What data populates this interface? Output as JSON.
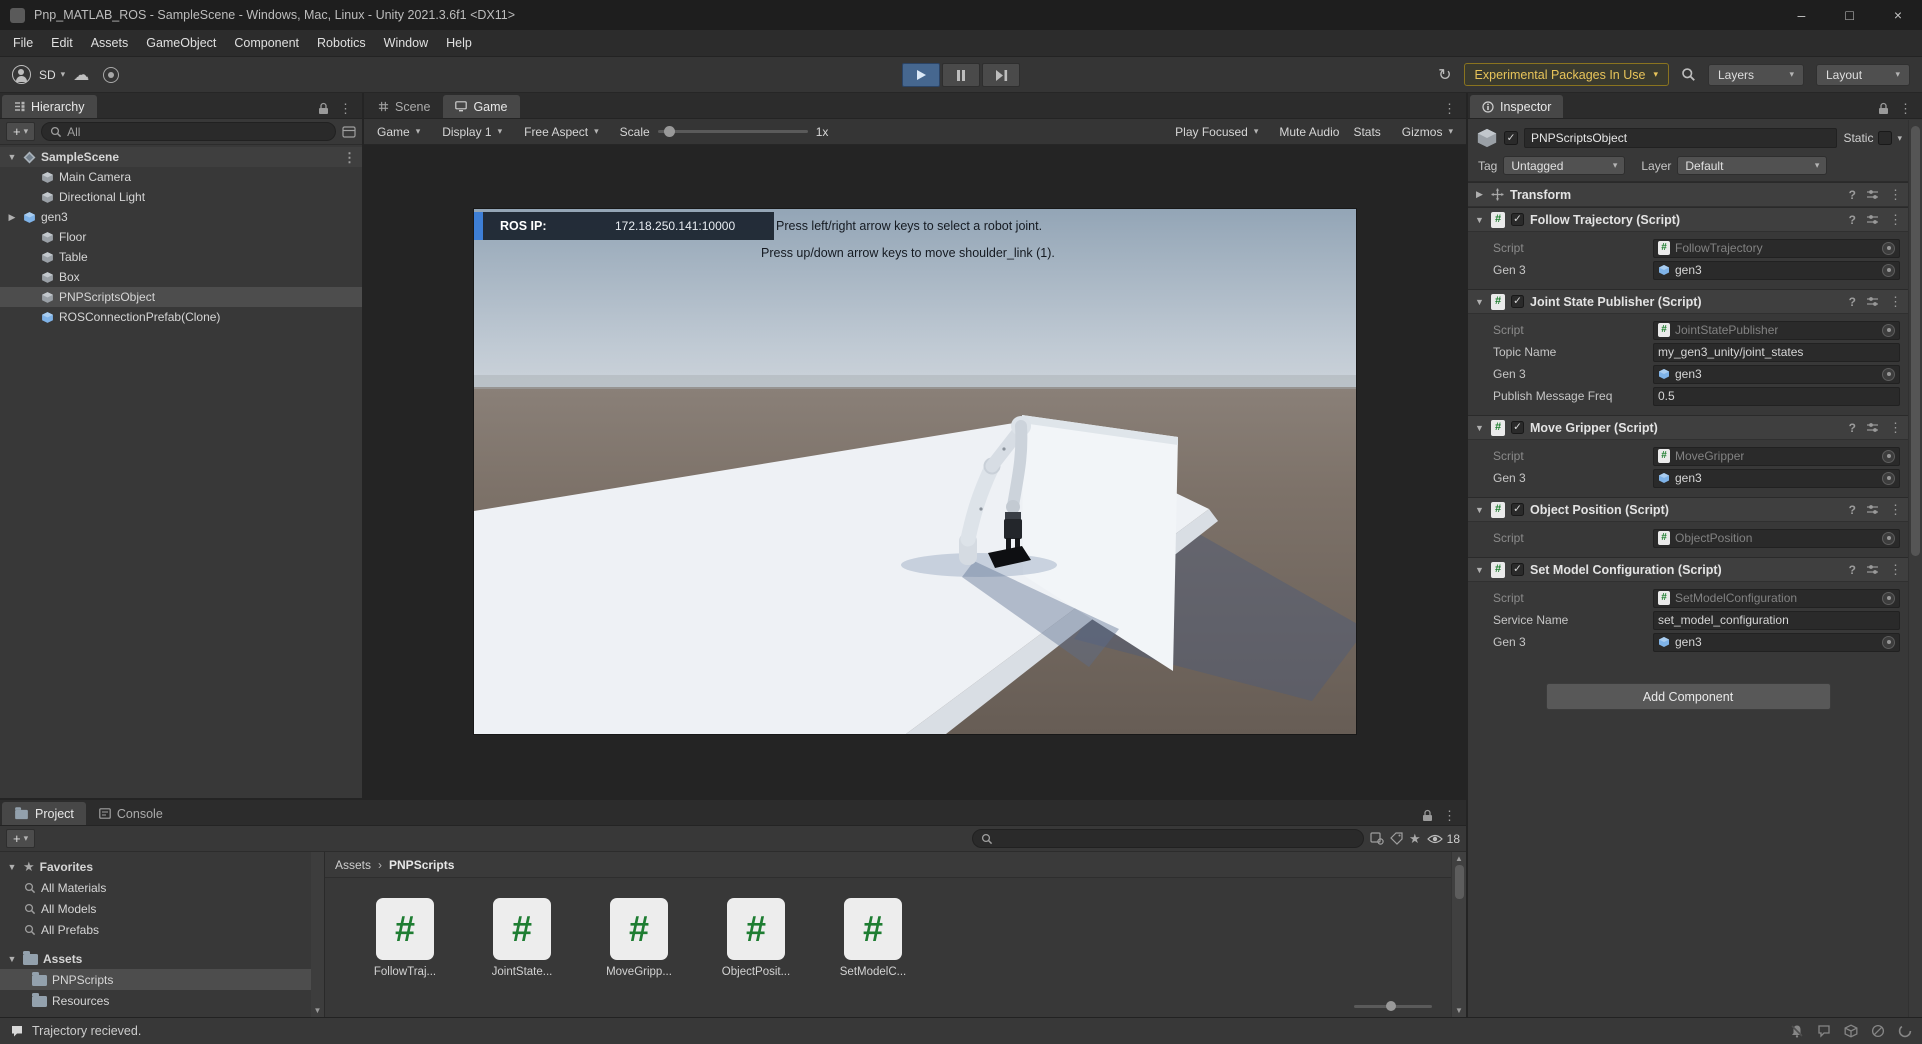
{
  "window": {
    "title": "Pnp_MATLAB_ROS - SampleScene - Windows, Mac, Linux - Unity 2021.3.6f1 <DX11>"
  },
  "menu": {
    "items": [
      "File",
      "Edit",
      "Assets",
      "GameObject",
      "Component",
      "Robotics",
      "Window",
      "Help"
    ]
  },
  "toolbar": {
    "account_label": "SD",
    "warning_label": "Experimental Packages In Use",
    "layers_label": "Layers",
    "layout_label": "Layout"
  },
  "hierarchy": {
    "tab_label": "Hierarchy",
    "search_text": "All",
    "scene_name": "SampleScene",
    "items": [
      {
        "label": "Main Camera"
      },
      {
        "label": "Directional Light"
      },
      {
        "label": "gen3"
      },
      {
        "label": "Floor"
      },
      {
        "label": "Table"
      },
      {
        "label": "Box"
      },
      {
        "label": "PNPScriptsObject"
      },
      {
        "label": "ROSConnectionPrefab(Clone)"
      }
    ]
  },
  "game": {
    "scene_tab": "Scene",
    "game_tab": "Game",
    "target_dropdown": "Game",
    "display_dropdown": "Display 1",
    "aspect_dropdown": "Free Aspect",
    "scale_label": "Scale",
    "scale_value": "1x",
    "play_focused": "Play Focused",
    "mute_audio": "Mute Audio",
    "stats": "Stats",
    "gizmos": "Gizmos",
    "overlay": {
      "ros_ip_label": "ROS IP:",
      "ros_ip_value": "172.18.250.141:10000",
      "hint_line1": "Press left/right arrow keys to select a robot joint.",
      "hint_line2": "Press up/down arrow keys to move shoulder_link (1)."
    }
  },
  "inspector": {
    "tab_label": "Inspector",
    "object_name": "PNPScriptsObject",
    "static_label": "Static",
    "tag_label": "Tag",
    "tag_value": "Untagged",
    "layer_label": "Layer",
    "layer_value": "Default",
    "transform_title": "Transform",
    "components": [
      {
        "title": "Follow Trajectory (Script)",
        "fields": [
          {
            "label": "Script",
            "value": "FollowTrajectory"
          },
          {
            "label": "Gen 3",
            "value": "gen3"
          }
        ]
      },
      {
        "title": "Joint State Publisher (Script)",
        "fields": [
          {
            "label": "Script",
            "value": "JointStatePublisher"
          },
          {
            "label": "Topic Name",
            "value": "my_gen3_unity/joint_states"
          },
          {
            "label": "Gen 3",
            "value": "gen3"
          },
          {
            "label": "Publish Message Freq",
            "value": "0.5"
          }
        ]
      },
      {
        "title": "Move Gripper (Script)",
        "fields": [
          {
            "label": "Script",
            "value": "MoveGripper"
          },
          {
            "label": "Gen 3",
            "value": "gen3"
          }
        ]
      },
      {
        "title": "Object Position (Script)",
        "fields": [
          {
            "label": "Script",
            "value": "ObjectPosition"
          }
        ]
      },
      {
        "title": "Set Model Configuration (Script)",
        "fields": [
          {
            "label": "Script",
            "value": "SetModelConfiguration"
          },
          {
            "label": "Service Name",
            "value": "set_model_configuration"
          },
          {
            "label": "Gen 3",
            "value": "gen3"
          }
        ]
      }
    ],
    "add_component_label": "Add Component"
  },
  "project": {
    "project_tab": "Project",
    "console_tab": "Console",
    "favorites_label": "Favorites",
    "favorites": [
      {
        "label": "All Materials"
      },
      {
        "label": "All Models"
      },
      {
        "label": "All Prefabs"
      }
    ],
    "assets_label": "Assets",
    "folders": [
      {
        "label": "PNPScripts"
      },
      {
        "label": "Resources"
      }
    ],
    "breadcrumb_root": "Assets",
    "breadcrumb_current": "PNPScripts",
    "visible_count": "18",
    "files": [
      {
        "label": "FollowTraj..."
      },
      {
        "label": "JointState..."
      },
      {
        "label": "MoveGripp..."
      },
      {
        "label": "ObjectPosit..."
      },
      {
        "label": "SetModelC..."
      }
    ]
  },
  "status_bar": {
    "message": "Trajectory recieved."
  },
  "icons": {
    "caret_down": "▾",
    "kebab": "⋮",
    "check": "✓",
    "foldout_open": "▼",
    "foldout_closed": "▶",
    "star": "★",
    "help": "?",
    "history": "↻",
    "cloud": "☁",
    "minimize": "–",
    "maximize": "□",
    "close": "×",
    "plus": "+",
    "breadcrumb_sep": "›",
    "scroll_up": "▲",
    "scroll_down": "▼",
    "hash": "#"
  }
}
